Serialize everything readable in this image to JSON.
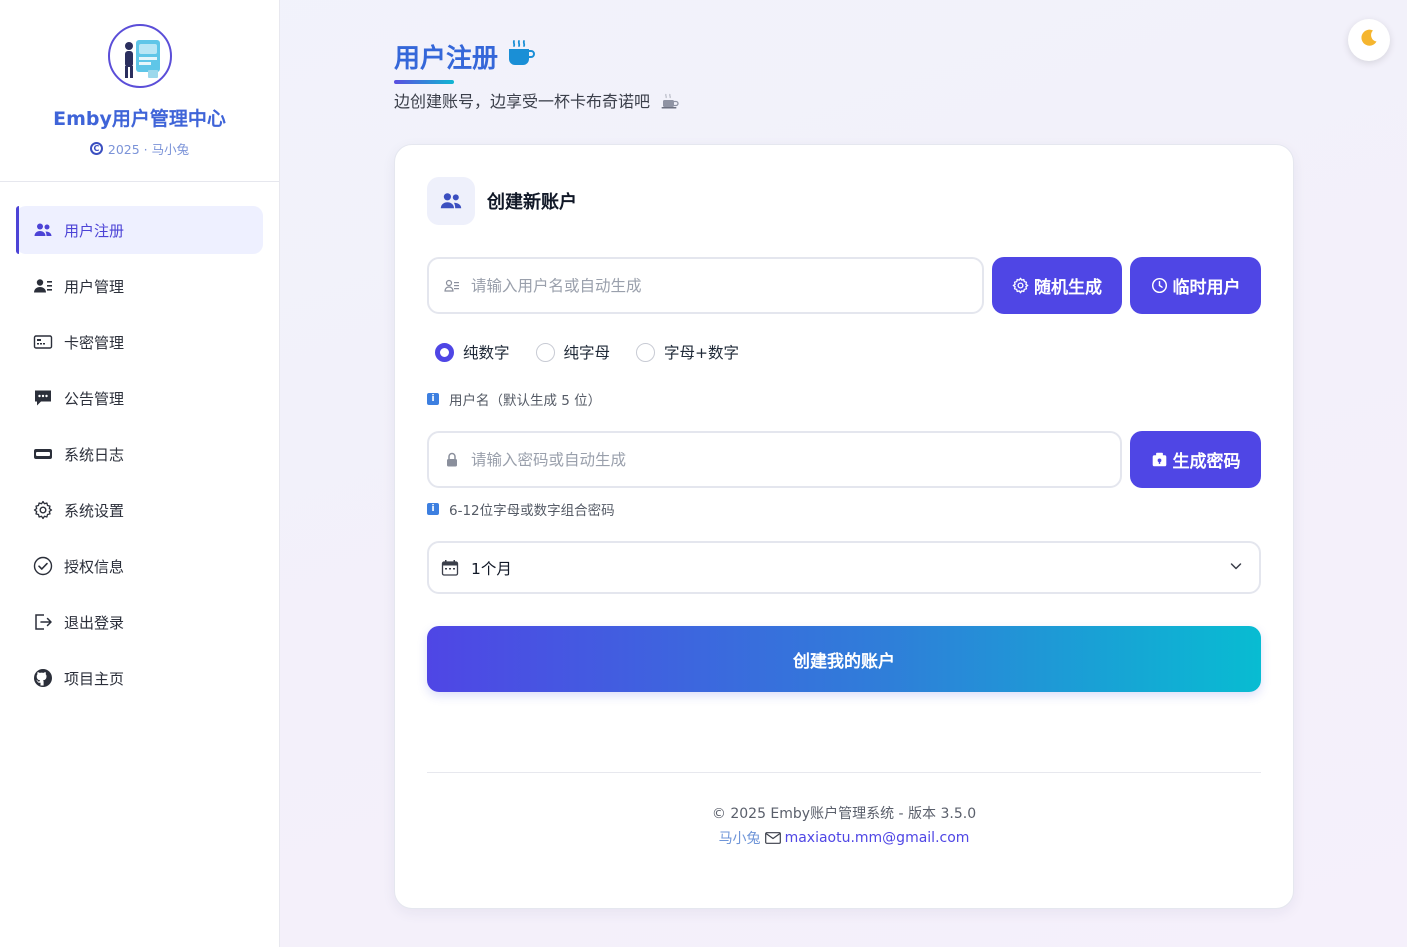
{
  "sidebar": {
    "brand_title": "Emby用户管理中心",
    "brand_sub": "2025 · 马小兔",
    "items": [
      {
        "label": "用户注册",
        "icon": "users-icon",
        "active": true
      },
      {
        "label": "用户管理",
        "icon": "user-list-icon"
      },
      {
        "label": "卡密管理",
        "icon": "card-icon"
      },
      {
        "label": "公告管理",
        "icon": "chat-icon"
      },
      {
        "label": "系统日志",
        "icon": "log-icon"
      },
      {
        "label": "系统设置",
        "icon": "gear-icon"
      },
      {
        "label": "授权信息",
        "icon": "check-circle-icon"
      },
      {
        "label": "退出登录",
        "icon": "logout-icon"
      },
      {
        "label": "项目主页",
        "icon": "github-icon"
      }
    ]
  },
  "header": {
    "title": "用户注册",
    "title_emoji": "☕",
    "subtitle": "边创建账号，边享受一杯卡布奇诺吧"
  },
  "theme_toggle_icon": "moon-icon",
  "form": {
    "card_title": "创建新账户",
    "username_placeholder": "请输入用户名或自动生成",
    "random_button": "随机生成",
    "temp_user_button": "临时用户",
    "radio_options": [
      "纯数字",
      "纯字母",
      "字母+数字"
    ],
    "radio_selected": "纯数字",
    "username_hint": "用户名（默认生成 5 位）",
    "password_placeholder": "请输入密码或自动生成",
    "gen_password_button": "生成密码",
    "password_hint": "6-12位字母或数字组合密码",
    "duration_value": "1个月",
    "submit_label": "创建我的账户"
  },
  "footer": {
    "line1": "© 2025 Emby账户管理系统 - 版本 3.5.0",
    "author": "马小兔",
    "email": "maxiaotu.mm@gmail.com"
  },
  "colors": {
    "primary": "#4f46e5",
    "accent": "#3567d9",
    "cyan": "#08bcd2"
  }
}
